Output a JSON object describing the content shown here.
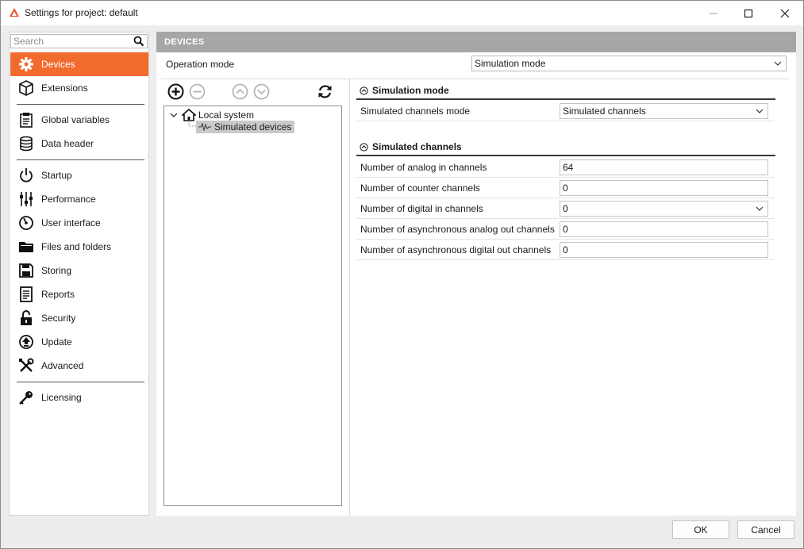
{
  "window": {
    "title": "Settings for project: default",
    "accent_color": "#f26b2e"
  },
  "search": {
    "placeholder": "Search",
    "value": ""
  },
  "sidebar": {
    "items": [
      {
        "label": "Devices",
        "icon": "gear-icon",
        "active": true
      },
      {
        "label": "Extensions",
        "icon": "cube-icon"
      },
      {
        "label": "Global variables",
        "icon": "clipboard-icon"
      },
      {
        "label": "Data header",
        "icon": "database-icon"
      },
      {
        "label": "Startup",
        "icon": "power-icon"
      },
      {
        "label": "Performance",
        "icon": "sliders-icon"
      },
      {
        "label": "User interface",
        "icon": "gauge-icon"
      },
      {
        "label": "Files and folders",
        "icon": "folder-icon"
      },
      {
        "label": "Storing",
        "icon": "floppy-icon"
      },
      {
        "label": "Reports",
        "icon": "report-icon"
      },
      {
        "label": "Security",
        "icon": "lock-icon"
      },
      {
        "label": "Update",
        "icon": "upload-icon"
      },
      {
        "label": "Advanced",
        "icon": "tools-icon"
      },
      {
        "label": "Licensing",
        "icon": "key-icon"
      }
    ]
  },
  "main": {
    "header": "DEVICES",
    "operation_mode": {
      "label": "Operation mode",
      "value": "Simulation mode"
    },
    "tree": {
      "root": "Local system",
      "child": "Simulated devices"
    },
    "sections": {
      "simulation_mode": {
        "title": "Simulation mode",
        "rows": [
          {
            "label": "Simulated channels mode",
            "value": "Simulated channels",
            "type": "select"
          }
        ]
      },
      "simulated_channels": {
        "title": "Simulated channels",
        "rows": [
          {
            "label": "Number of analog in channels",
            "value": "64",
            "type": "input"
          },
          {
            "label": "Number of counter channels",
            "value": "0",
            "type": "input"
          },
          {
            "label": "Number of digital in channels",
            "value": "0",
            "type": "select"
          },
          {
            "label": "Number of asynchronous analog out channels",
            "value": "0",
            "type": "input"
          },
          {
            "label": "Number of asynchronous digital out channels",
            "value": "0",
            "type": "input"
          }
        ]
      }
    }
  },
  "footer": {
    "ok_label": "OK",
    "cancel_label": "Cancel"
  }
}
